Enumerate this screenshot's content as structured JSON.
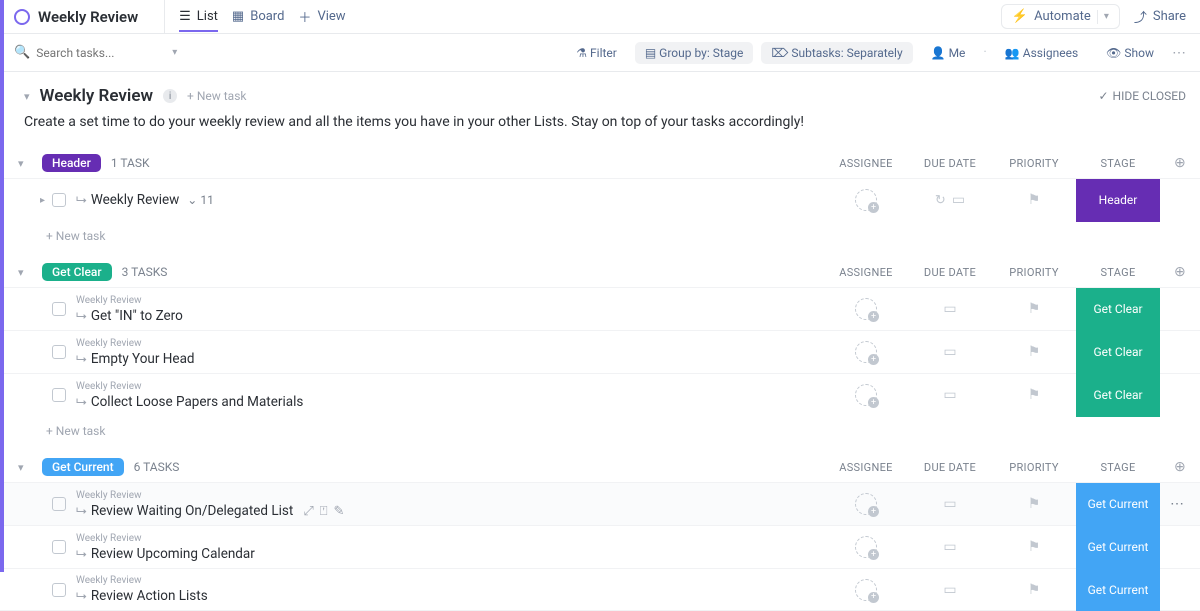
{
  "header": {
    "title": "Weekly Review",
    "tabs": [
      {
        "label": "List",
        "active": true
      },
      {
        "label": "Board",
        "active": false
      },
      {
        "label": "View",
        "active": false
      }
    ],
    "automate": "Automate",
    "share": "Share"
  },
  "filterbar": {
    "search_placeholder": "Search tasks...",
    "filter": "Filter",
    "group": "Group by: Stage",
    "subtasks": "Subtasks: Separately",
    "me": "Me",
    "assignees": "Assignees",
    "show": "Show"
  },
  "section": {
    "heading": "Weekly Review",
    "new_task": "+ New task",
    "hide_closed": "HIDE CLOSED",
    "description": "Create a set time to do your weekly review and all the items you have in your other Lists. Stay on top of your tasks accordingly!"
  },
  "columns": {
    "assignee": "Assignee",
    "due": "Due date",
    "priority": "Priority",
    "stage": "Stage"
  },
  "colors": {
    "header": "#662db3",
    "get_clear": "#1bb08b",
    "get_current": "#42a5f5"
  },
  "groups": [
    {
      "id": "header",
      "label": "Header",
      "count": "1 TASK",
      "stage_label": "Header",
      "stage_color": "#662db3",
      "tasks": [
        {
          "name": "Weekly Review",
          "crumb": "",
          "subcount": "11",
          "caret": true,
          "due_icons": true
        }
      ],
      "new_task": "+ New task"
    },
    {
      "id": "get_clear",
      "label": "Get Clear",
      "count": "3 TASKS",
      "stage_label": "Get Clear",
      "stage_color": "#1bb08b",
      "tasks": [
        {
          "name": "Get \"IN\" to Zero",
          "crumb": "Weekly Review"
        },
        {
          "name": "Empty Your Head",
          "crumb": "Weekly Review"
        },
        {
          "name": "Collect Loose Papers and Materials",
          "crumb": "Weekly Review"
        }
      ],
      "new_task": "+ New task"
    },
    {
      "id": "get_current",
      "label": "Get Current",
      "count": "6 TASKS",
      "stage_label": "Get Current",
      "stage_color": "#42a5f5",
      "tasks": [
        {
          "name": "Review Waiting On/Delegated List",
          "crumb": "Weekly Review",
          "hovered": true,
          "extra_icons": true
        },
        {
          "name": "Review Upcoming Calendar",
          "crumb": "Weekly Review"
        },
        {
          "name": "Review Action Lists",
          "crumb": "Weekly Review"
        }
      ]
    }
  ]
}
